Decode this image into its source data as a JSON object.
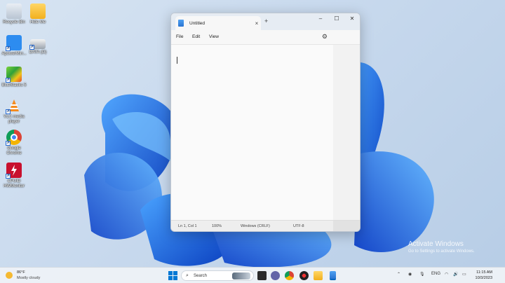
{
  "desktop": {
    "icons": [
      {
        "label": "Recycle Bin"
      },
      {
        "label": "Hide Me"
      },
      {
        "label": "ApowerMirr..."
      },
      {
        "label": "DATA (D)"
      },
      {
        "label": "BlueStacks 5"
      },
      {
        "label": "VLC media player"
      },
      {
        "label": "Google Chrome"
      },
      {
        "label": "CPUID HWMonitor"
      }
    ]
  },
  "notepad": {
    "tab_title": "Untitled",
    "menu": [
      "File",
      "Edit",
      "View"
    ],
    "content": "",
    "status": {
      "position": "Ln 1, Col 1",
      "zoom": "100%",
      "line_endings": "Windows (CRLF)",
      "encoding": "UTF-8"
    }
  },
  "watermark": {
    "line1": "Activate Windows",
    "line2": "Go to Settings to activate Windows."
  },
  "taskbar": {
    "weather_temp": "86°F",
    "weather_desc": "Mostly cloudy",
    "search_placeholder": "Search",
    "language": "ENG",
    "time": "11:15 AM",
    "date": "10/3/2023"
  },
  "colors": {
    "accent": "#0067c0",
    "wallpaper_blue": "#1c6ee8"
  }
}
